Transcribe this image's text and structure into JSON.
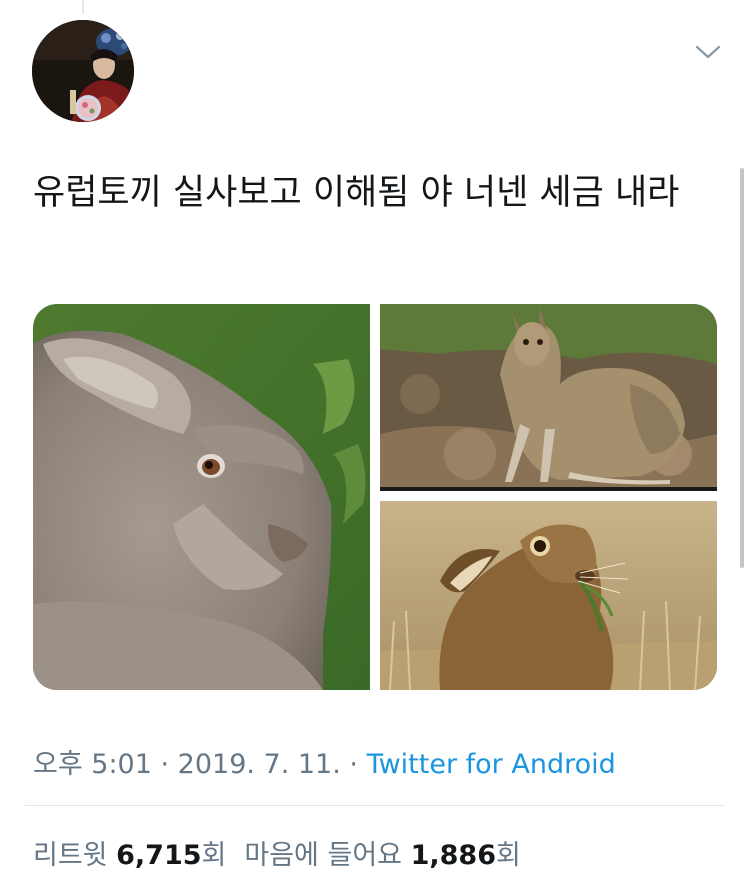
{
  "tweet": {
    "text": "유럽토끼 실사보고 이해됨 야 너넨 세금 내라",
    "images": [
      {
        "name": "hare-closeup-photo"
      },
      {
        "name": "hare-sitting-photo"
      },
      {
        "name": "hare-eating-grass-photo"
      }
    ]
  },
  "meta": {
    "time": "오후 5:01",
    "separator1": " · ",
    "date": "2019. 7. 11.",
    "separator2": " · ",
    "source": "Twitter for Android"
  },
  "stats": {
    "retweets_label": "리트윗",
    "retweets_count": "6,715",
    "retweets_unit": "회",
    "likes_label": "마음에 들어요",
    "likes_count": "1,886",
    "likes_unit": "회"
  },
  "icons": {
    "menu": "chevron-down-icon"
  },
  "colors": {
    "text": "#14171a",
    "muted": "#657786",
    "link": "#1b95e0",
    "divider": "#e1e8ed"
  }
}
